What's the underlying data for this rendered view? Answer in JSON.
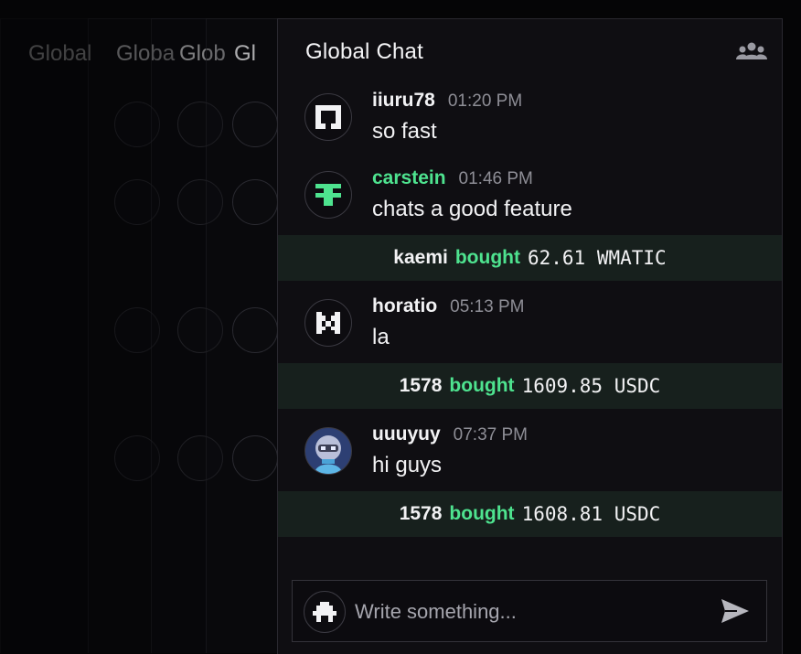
{
  "chat": {
    "title": "Global Chat",
    "messages": [
      {
        "username": "iiuru78",
        "time": "01:20 PM",
        "text": "so fast"
      },
      {
        "username": "carstein",
        "time": "01:46 PM",
        "text": "chats a good feature"
      },
      {
        "username": "horatio",
        "time": "05:13 PM",
        "text": "la"
      },
      {
        "username": "uuuyuy",
        "time": "07:37 PM",
        "text": "hi guys"
      }
    ],
    "trades": [
      {
        "user": "kaemi",
        "verb": "bought",
        "amount": "62.61 WMATIC"
      },
      {
        "user": "1578",
        "verb": "bought",
        "amount": "1609.85 USDC"
      },
      {
        "user": "1578",
        "verb": "bought",
        "amount": "1608.81 USDC"
      }
    ],
    "composer": {
      "placeholder": "Write something..."
    }
  },
  "ghost_titles": [
    "Global",
    "Globa",
    "Glob",
    "Gl"
  ],
  "icons": {
    "users": "users-group-icon",
    "send": "send-icon"
  },
  "colors": {
    "accent": "#4ee38f",
    "background": "#0f0e12",
    "trade_row": "#17201d"
  }
}
